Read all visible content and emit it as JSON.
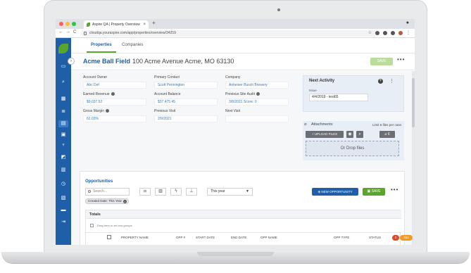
{
  "browser": {
    "tab_title": "Aspire QA | Property Overview",
    "tab_close": "×",
    "new_tab": "+",
    "url": "cloudqa.youraspire.com/app/properties/overview/34259",
    "nav_back": "←",
    "nav_forward": "→",
    "nav_reload": "C"
  },
  "colors": {
    "sidebar": "#1e5fa8",
    "accent_green": "#5aa62c",
    "link_blue": "#2f7bc4"
  },
  "sidebar": {
    "items": [
      {
        "icon": "money-icon",
        "glyph": "▭"
      },
      {
        "icon": "search-icon",
        "glyph": "⌕"
      },
      {
        "icon": "calendar-icon",
        "glyph": "▦"
      },
      {
        "icon": "list-icon",
        "glyph": "≣"
      },
      {
        "icon": "grid-icon",
        "glyph": "▤"
      },
      {
        "icon": "dashboard-icon",
        "glyph": "▣"
      },
      {
        "icon": "trophy-icon",
        "glyph": "♆"
      },
      {
        "icon": "chart-icon",
        "glyph": "◩"
      },
      {
        "icon": "clipboard-icon",
        "glyph": "▥"
      },
      {
        "icon": "clock-icon",
        "glyph": "◷"
      },
      {
        "icon": "report-icon",
        "glyph": "▧"
      },
      {
        "icon": "archive-icon",
        "glyph": "▬"
      },
      {
        "icon": "exit-icon",
        "glyph": "⇥"
      }
    ],
    "collapse_glyph": "›"
  },
  "tabs": {
    "properties": "Properties",
    "companies": "Companies"
  },
  "header": {
    "name": "Acme Ball Field",
    "address": "100 Acme Avenue Acme, MO 63130",
    "save": "SAVE",
    "more": "•••"
  },
  "fields": {
    "account_owner": {
      "label": "Account Owner",
      "value": "Abc Def"
    },
    "primary_contact": {
      "label": "Primary Contact",
      "value": "Scott Pennington"
    },
    "company": {
      "label": "Company",
      "value": "Anheiser Busch Brewery"
    },
    "earned_revenue": {
      "label": "Earned Revenue",
      "value": "$9,037.52"
    },
    "account_balance": {
      "label": "Account Balance",
      "value": "$37,475.45"
    },
    "previous_site_audit": {
      "label": "Previous Site Audit",
      "value": "3/8/2021 Score: 0"
    },
    "gross_margin": {
      "label": "Gross Margin",
      "value": "62.03%"
    },
    "previous_visit": {
      "label": "Previous Visit",
      "value": "2/9/2021"
    },
    "next_visit": {
      "label": "Next Visit",
      "value": ""
    }
  },
  "next_activity": {
    "title": "Next Activity",
    "add": "+",
    "more": "⋮",
    "issue_label": "Issue",
    "issue_value": "4/4/2019 - test65"
  },
  "attachments": {
    "title": "Attachments",
    "limit": "Limit 5 files per case",
    "upload": "UPLOAD FILES",
    "count": "6",
    "drop": "Or Drop files"
  },
  "opportunities": {
    "title": "Opportunities",
    "search_placeholder": "Search...",
    "period": "This year",
    "new_button": "NEW OPPORTUNITY",
    "save": "SAVE",
    "more": "•••",
    "filter_chip": "Created Date: This Year",
    "totals": "Totals",
    "group_hint": "Drag here to set row groups",
    "columns": [
      "PROPERTY NAME",
      "OPP #",
      "START DATE",
      "END DATE",
      "OPP NAME",
      "OPP TYPE",
      "STATUS"
    ]
  },
  "badges": {
    "notif": "2",
    "count": "334"
  }
}
